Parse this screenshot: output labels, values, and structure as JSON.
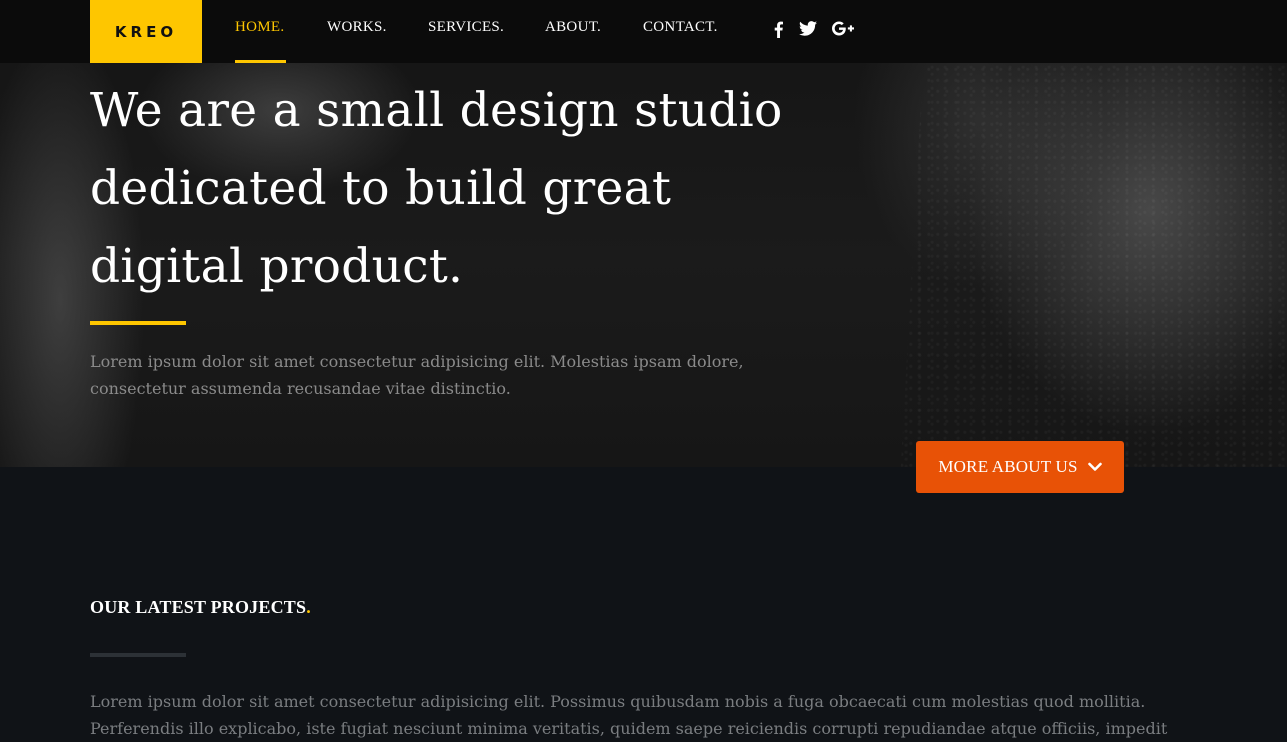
{
  "brand": {
    "logo": "KREO",
    "accent": "#fec600",
    "button_color": "#e85206"
  },
  "nav": {
    "items": [
      {
        "label": "HOME.",
        "active": true
      },
      {
        "label": "WORKS.",
        "active": false
      },
      {
        "label": "SERVICES.",
        "active": false
      },
      {
        "label": "ABOUT.",
        "active": false
      },
      {
        "label": "CONTACT.",
        "active": false
      }
    ],
    "social": [
      "facebook-icon",
      "twitter-icon",
      "google-plus-icon"
    ]
  },
  "hero": {
    "headline_lines": [
      "We are a small design studio",
      "dedicated to build great",
      "digital product."
    ],
    "text_lines": [
      "Lorem ipsum dolor sit amet consectetur adipisicing elit. Molestias ipsam dolore,",
      "consectetur assumenda recusandae vitae distinctio."
    ],
    "button_label": "MORE ABOUT US"
  },
  "projects": {
    "title": "OUR LATEST PROJECTS",
    "title_dot": ".",
    "text_lines": [
      "Lorem ipsum dolor sit amet consectetur adipisicing elit. Possimus quibusdam nobis a fuga obcaecati cum molestias quod mollitia.",
      "Perferendis illo explicabo, iste fugiat nesciunt minima veritatis, quidem saepe reiciendis corrupti repudiandae atque officiis, impedit"
    ]
  }
}
